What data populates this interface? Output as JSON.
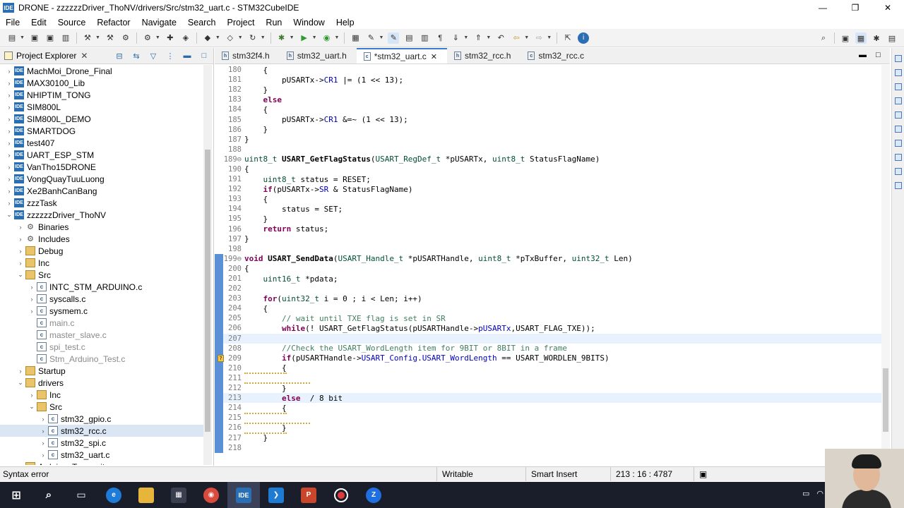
{
  "window": {
    "title": "DRONE - zzzzzzDriver_ThoNV/drivers/Src/stm32_uart.c - STM32CubeIDE",
    "app_icon_label": "IDE",
    "minimize": "—",
    "maximize": "❐",
    "close": "✕"
  },
  "menu": [
    "File",
    "Edit",
    "Source",
    "Refactor",
    "Navigate",
    "Search",
    "Project",
    "Run",
    "Window",
    "Help"
  ],
  "explorer": {
    "tab_label": "Project Explorer",
    "close": "✕",
    "tree": [
      {
        "label": "MachMoi_Drone_Final",
        "indent": 0,
        "arrow": "›",
        "icon": "proj"
      },
      {
        "label": "MAX30100_Lib",
        "indent": 0,
        "arrow": "›",
        "icon": "proj"
      },
      {
        "label": "NHIPTIM_TONG",
        "indent": 0,
        "arrow": "›",
        "icon": "proj"
      },
      {
        "label": "SIM800L",
        "indent": 0,
        "arrow": "›",
        "icon": "proj"
      },
      {
        "label": "SIM800L_DEMO",
        "indent": 0,
        "arrow": "›",
        "icon": "proj"
      },
      {
        "label": "SMARTDOG",
        "indent": 0,
        "arrow": "›",
        "icon": "proj"
      },
      {
        "label": "test407",
        "indent": 0,
        "arrow": "›",
        "icon": "proj"
      },
      {
        "label": "UART_ESP_STM",
        "indent": 0,
        "arrow": "›",
        "icon": "proj"
      },
      {
        "label": "VanTho15DRONE",
        "indent": 0,
        "arrow": "›",
        "icon": "proj"
      },
      {
        "label": "VongQuayTuuLuong",
        "indent": 0,
        "arrow": "›",
        "icon": "proj"
      },
      {
        "label": "Xe2BanhCanBang",
        "indent": 0,
        "arrow": "›",
        "icon": "proj"
      },
      {
        "label": "zzzTask",
        "indent": 0,
        "arrow": "›",
        "icon": "proj"
      },
      {
        "label": "zzzzzzDriver_ThoNV",
        "indent": 0,
        "arrow": "⌄",
        "icon": "proj"
      },
      {
        "label": "Binaries",
        "indent": 1,
        "arrow": "›",
        "icon": "bin"
      },
      {
        "label": "Includes",
        "indent": 1,
        "arrow": "›",
        "icon": "bin"
      },
      {
        "label": "Debug",
        "indent": 1,
        "arrow": "›",
        "icon": "folder"
      },
      {
        "label": "Inc",
        "indent": 1,
        "arrow": "›",
        "icon": "folder"
      },
      {
        "label": "Src",
        "indent": 1,
        "arrow": "⌄",
        "icon": "folder"
      },
      {
        "label": "INTC_STM_ARDUINO.c",
        "indent": 2,
        "arrow": "›",
        "icon": "file"
      },
      {
        "label": "syscalls.c",
        "indent": 2,
        "arrow": "›",
        "icon": "file"
      },
      {
        "label": "sysmem.c",
        "indent": 2,
        "arrow": "›",
        "icon": "file"
      },
      {
        "label": "main.c",
        "indent": 2,
        "arrow": "",
        "icon": "file",
        "dim": true
      },
      {
        "label": "master_slave.c",
        "indent": 2,
        "arrow": "",
        "icon": "file",
        "dim": true
      },
      {
        "label": "spi_test.c",
        "indent": 2,
        "arrow": "",
        "icon": "file",
        "dim": true
      },
      {
        "label": "Stm_Arduino_Test.c",
        "indent": 2,
        "arrow": "",
        "icon": "file",
        "dim": true
      },
      {
        "label": "Startup",
        "indent": 1,
        "arrow": "›",
        "icon": "folder"
      },
      {
        "label": "drivers",
        "indent": 1,
        "arrow": "⌄",
        "icon": "folder"
      },
      {
        "label": "Inc",
        "indent": 2,
        "arrow": "›",
        "icon": "folder"
      },
      {
        "label": "Src",
        "indent": 2,
        "arrow": "⌄",
        "icon": "folder"
      },
      {
        "label": "stm32_gpio.c",
        "indent": 3,
        "arrow": "›",
        "icon": "file"
      },
      {
        "label": "stm32_rcc.c",
        "indent": 3,
        "arrow": "›",
        "icon": "file",
        "selected": true
      },
      {
        "label": "stm32_spi.c",
        "indent": 3,
        "arrow": "›",
        "icon": "file"
      },
      {
        "label": "stm32_uart.c",
        "indent": 3,
        "arrow": "›",
        "icon": "file"
      },
      {
        "label": "Arduino_Transmit",
        "indent": 1,
        "arrow": "›",
        "icon": "folder"
      }
    ]
  },
  "editor": {
    "tabs": [
      {
        "label": "stm32f4.h",
        "icon": "h"
      },
      {
        "label": "stm32_uart.h",
        "icon": "h"
      },
      {
        "label": "*stm32_uart.c",
        "icon": "c",
        "active": true,
        "close": "✕"
      },
      {
        "label": "stm32_rcc.h",
        "icon": "h"
      },
      {
        "label": "stm32_rcc.c",
        "icon": "c"
      }
    ],
    "lines": [
      {
        "n": "180",
        "html": "    {"
      },
      {
        "n": "181",
        "html": "        pUSARTx-><span class=\"mb\">CR1</span> |= (1 << 13);"
      },
      {
        "n": "182",
        "html": "    }"
      },
      {
        "n": "183",
        "html": "    <span class=\"kw\">else</span>"
      },
      {
        "n": "184",
        "html": "    {"
      },
      {
        "n": "185",
        "html": "        pUSARTx-><span class=\"mb\">CR1</span> &=~ (1 << 13);"
      },
      {
        "n": "186",
        "html": "    }"
      },
      {
        "n": "187",
        "html": "}"
      },
      {
        "n": "188",
        "html": ""
      },
      {
        "n": "189⊖",
        "html": "<span class=\"ty\">uint8_t</span> <span class=\"fn\">USART_GetFlagStatus</span>(<span class=\"ty\">USART_RegDef_t</span> *pUSARTx, <span class=\"ty\">uint8_t</span> StatusFlagName)"
      },
      {
        "n": "190",
        "html": "{"
      },
      {
        "n": "191",
        "html": "    <span class=\"ty\">uint8_t</span> status = RESET;"
      },
      {
        "n": "192",
        "html": "    <span class=\"kw\">if</span>(pUSARTx-><span class=\"mb\">SR</span> & StatusFlagName)"
      },
      {
        "n": "193",
        "html": "    {"
      },
      {
        "n": "194",
        "html": "        status = SET;"
      },
      {
        "n": "195",
        "html": "    }"
      },
      {
        "n": "196",
        "html": "    <span class=\"kw\">return</span> status;"
      },
      {
        "n": "197",
        "html": "}"
      },
      {
        "n": "198",
        "html": ""
      },
      {
        "n": "199⊖",
        "html": "<span class=\"kw\">void</span> <span class=\"fn\">USART_SendData</span>(<span class=\"ty\">USART_Handle_t</span> *pUSARTHandle, <span class=\"ty\">uint8_t</span> *pTxBuffer, <span class=\"ty\">uint32_t</span> Len)",
        "blue": true
      },
      {
        "n": "200",
        "html": "{",
        "blue": true
      },
      {
        "n": "201",
        "html": "    <span class=\"ty\">uint16_t</span> *pdata;",
        "blue": true
      },
      {
        "n": "202",
        "html": "",
        "blue": true
      },
      {
        "n": "203",
        "html": "    <span class=\"kw\">for</span>(<span class=\"ty\">uint32_t</span> i = 0 ; i < Len; i++)",
        "blue": true
      },
      {
        "n": "204",
        "html": "    {",
        "blue": true
      },
      {
        "n": "205",
        "html": "        <span class=\"cm\">// wait until TXE flag is set in SR</span>",
        "blue": true
      },
      {
        "n": "206",
        "html": "        <span class=\"kw\">while</span>(! USART_GetFlagStatus(pUSARTHandle-><span class=\"mb\">pUSARTx</span>,USART_FLAG_TXE));",
        "blue": true
      },
      {
        "n": "207",
        "html": "",
        "blue": true,
        "current": true
      },
      {
        "n": "208",
        "html": "        <span class=\"cm\">//Check the USART_WordLength item for 9BIT or 8BIT in a frame</span>",
        "blue": true
      },
      {
        "n": "209",
        "html": "        <span class=\"kw\">if</span>(pUSARTHandle-><span class=\"mb\">USART_Config</span>.<span class=\"mb\">USART_WordLength</span> == USART_WORDLEN_9BITS)",
        "blue": true,
        "warn": true
      },
      {
        "n": "210",
        "html": "<span class=\"squig\">        {</span>",
        "blue": true
      },
      {
        "n": "211",
        "html": "<span class=\"squig\">              </span>",
        "blue": true
      },
      {
        "n": "212",
        "html": "<span class=\"squig\">        }</span>",
        "blue": true
      },
      {
        "n": "213",
        "html": "        <span class=\"kw\">else</span>  / 8 bit",
        "blue": true,
        "current": true
      },
      {
        "n": "214",
        "html": "<span class=\"squig\">        {</span>",
        "blue": true
      },
      {
        "n": "215",
        "html": "<span class=\"squig\">              </span>",
        "blue": true
      },
      {
        "n": "216",
        "html": "<span class=\"squig\">        }</span>",
        "blue": true
      },
      {
        "n": "217",
        "html": "    }",
        "blue": true
      },
      {
        "n": "218",
        "html": "",
        "blue": true
      }
    ]
  },
  "status": {
    "message": "Syntax error",
    "writable": "Writable",
    "insert_mode": "Smart Insert",
    "position": "213 : 16 : 4787"
  },
  "taskbar": {
    "ide_label": "IDE",
    "ppt_label": "P",
    "zalo_label": "Z"
  }
}
